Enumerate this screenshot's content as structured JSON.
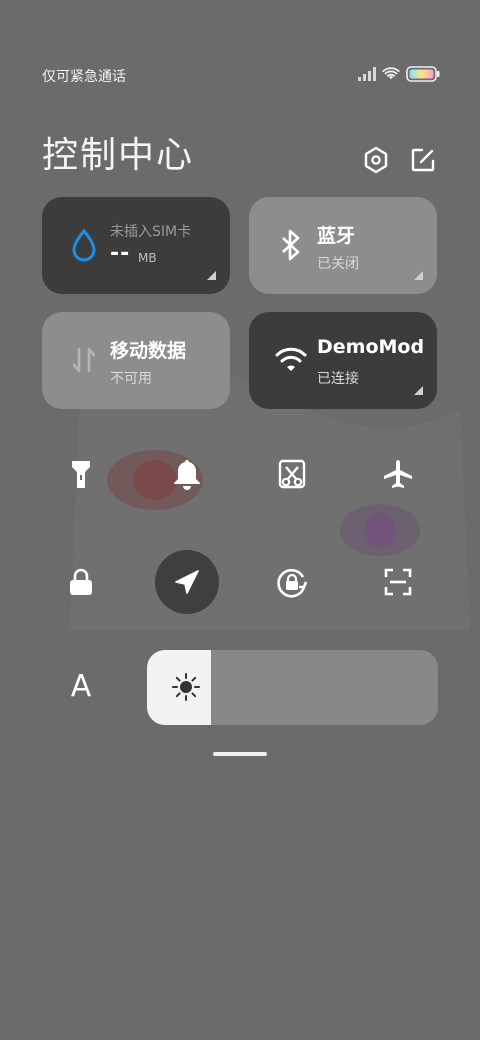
{
  "status": {
    "carrier": "仅可紧急通话"
  },
  "header": {
    "title": "控制中心"
  },
  "tiles": {
    "sim": {
      "line1": "未插入SIM卡",
      "value": "--",
      "unit": "MB"
    },
    "bluetooth": {
      "name": "蓝牙",
      "state": "已关闭"
    },
    "mobile_data": {
      "name": "移动数据",
      "state": "不可用"
    },
    "wifi": {
      "name": "DemoMode",
      "state": "已连接"
    }
  },
  "font_button": {
    "label": "A"
  },
  "brightness": {
    "level": 0.22
  },
  "colors": {
    "background": "#6b6b6b",
    "tile_active": "#3c3c3c",
    "tile_inactive": "#8d8d8d",
    "accent_blue": "#1e8fe6"
  }
}
